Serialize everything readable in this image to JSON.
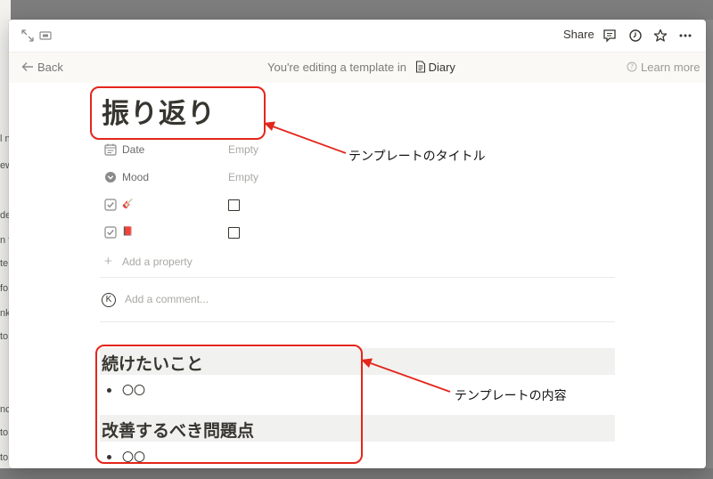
{
  "topbar": {
    "share_label": "Share",
    "icons": [
      "expand-icon",
      "peek-mode-icon",
      "comment-icon",
      "clock-icon",
      "star-icon",
      "more-icon"
    ]
  },
  "editbar": {
    "back_label": "Back",
    "editing_prefix": "You're editing a template in",
    "database_name": "Diary",
    "learn_more_label": "Learn more"
  },
  "page": {
    "title": "振り返り",
    "properties": [
      {
        "name": "Date",
        "value": "Empty",
        "icon": "calendar-icon"
      },
      {
        "name": "Mood",
        "value": "Empty",
        "icon": "select-icon"
      },
      {
        "name": "🎸",
        "type": "checkbox",
        "checked": false,
        "icon": "checkbox-icon"
      },
      {
        "name": "📕",
        "type": "checkbox",
        "checked": false,
        "icon": "checkbox-icon"
      }
    ],
    "add_property_label": "Add a property",
    "comment_avatar": "K",
    "comment_placeholder": "Add a comment...",
    "sections": [
      {
        "heading": "続けたいこと",
        "bullets": [
          "〇〇"
        ]
      },
      {
        "heading": "改善するべき問題点",
        "bullets": [
          "〇〇"
        ]
      }
    ]
  },
  "annotations": {
    "title_note": "テンプレートのタイトル",
    "content_note": "テンプレートの内容",
    "color": "#e3261b"
  }
}
